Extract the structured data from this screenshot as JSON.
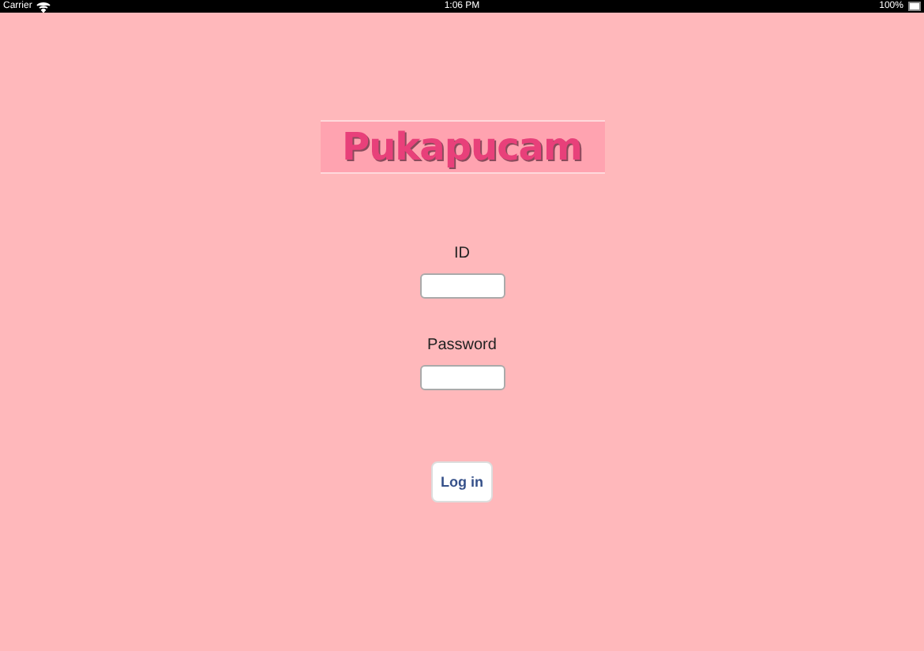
{
  "status_bar": {
    "carrier": "Carrier",
    "time": "1:06 PM",
    "battery": "100%"
  },
  "logo": {
    "text": "Pukapucam"
  },
  "fields": [
    {
      "label": "ID"
    },
    {
      "label": "Password"
    }
  ],
  "button": {
    "label": "Log in"
  }
}
